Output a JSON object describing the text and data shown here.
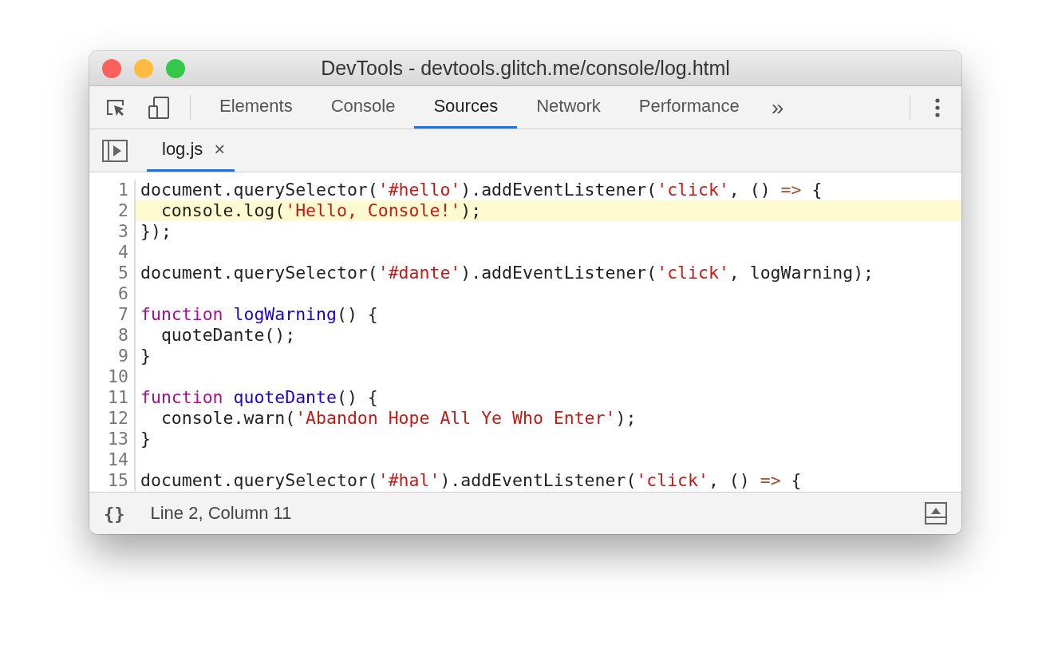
{
  "window": {
    "title": "DevTools - devtools.glitch.me/console/log.html"
  },
  "tabs": [
    {
      "label": "Elements",
      "selected": false
    },
    {
      "label": "Console",
      "selected": false
    },
    {
      "label": "Sources",
      "selected": true
    },
    {
      "label": "Network",
      "selected": false
    },
    {
      "label": "Performance",
      "selected": false
    }
  ],
  "more_tabs": "»",
  "file_tabs": [
    {
      "label": "log.js",
      "close": "×",
      "selected": true
    }
  ],
  "code": {
    "lines": [
      {
        "number": "1",
        "highlighted": false,
        "tokens": [
          {
            "kind": "plain",
            "text": "document.querySelector("
          },
          {
            "kind": "string",
            "text": "'#hello'"
          },
          {
            "kind": "plain",
            "text": ").addEventListener("
          },
          {
            "kind": "string",
            "text": "'click'"
          },
          {
            "kind": "plain",
            "text": ", () "
          },
          {
            "kind": "operator",
            "text": "=>"
          },
          {
            "kind": "plain",
            "text": " {"
          }
        ]
      },
      {
        "number": "2",
        "highlighted": true,
        "tokens": [
          {
            "kind": "plain",
            "text": "  console.log("
          },
          {
            "kind": "string",
            "text": "'Hello, Console!'"
          },
          {
            "kind": "plain",
            "text": ");"
          }
        ]
      },
      {
        "number": "3",
        "highlighted": false,
        "tokens": [
          {
            "kind": "plain",
            "text": "});"
          }
        ]
      },
      {
        "number": "4",
        "highlighted": false
      },
      {
        "number": "5",
        "highlighted": false,
        "tokens": [
          {
            "kind": "plain",
            "text": "document.querySelector("
          },
          {
            "kind": "string",
            "text": "'#dante'"
          },
          {
            "kind": "plain",
            "text": ").addEventListener("
          },
          {
            "kind": "string",
            "text": "'click'"
          },
          {
            "kind": "plain",
            "text": ", logWarning);"
          }
        ]
      },
      {
        "number": "6",
        "highlighted": false
      },
      {
        "number": "7",
        "highlighted": false,
        "tokens": [
          {
            "kind": "keyword",
            "text": "function"
          },
          {
            "kind": "function",
            "text": "logWarning"
          },
          {
            "kind": "plain",
            "text": "() {"
          }
        ]
      },
      {
        "number": "8",
        "highlighted": false,
        "tokens": [
          {
            "kind": "plain",
            "text": "  quoteDante();"
          }
        ]
      },
      {
        "number": "9",
        "highlighted": false,
        "tokens": [
          {
            "kind": "plain",
            "text": "}"
          }
        ]
      },
      {
        "number": "10",
        "highlighted": false
      },
      {
        "number": "11",
        "highlighted": false,
        "tokens": [
          {
            "kind": "keyword",
            "text": "function"
          },
          {
            "kind": "function",
            "text": "quoteDante"
          },
          {
            "kind": "plain",
            "text": "() {"
          }
        ]
      },
      {
        "number": "12",
        "highlighted": false,
        "tokens": [
          {
            "kind": "plain",
            "text": "  console.warn("
          },
          {
            "kind": "string",
            "text": "'Abandon Hope All Ye Who Enter'"
          },
          {
            "kind": "plain",
            "text": ");"
          }
        ]
      },
      {
        "number": "13",
        "highlighted": false,
        "tokens": [
          {
            "kind": "plain",
            "text": "}"
          }
        ]
      },
      {
        "number": "14",
        "highlighted": false
      },
      {
        "number": "15",
        "highlighted": false,
        "tokens": [
          {
            "kind": "plain",
            "text": "document.querySelector("
          },
          {
            "kind": "string",
            "text": "'#hal'"
          },
          {
            "kind": "plain",
            "text": ").addEventListener("
          },
          {
            "kind": "string",
            "text": "'click'"
          },
          {
            "kind": "plain",
            "text": ", () "
          },
          {
            "kind": "operator",
            "text": "=>"
          },
          {
            "kind": "plain",
            "text": " {"
          }
        ]
      }
    ]
  },
  "status_bar": {
    "format_button": "{}",
    "position": "Line 2, Column 11"
  }
}
